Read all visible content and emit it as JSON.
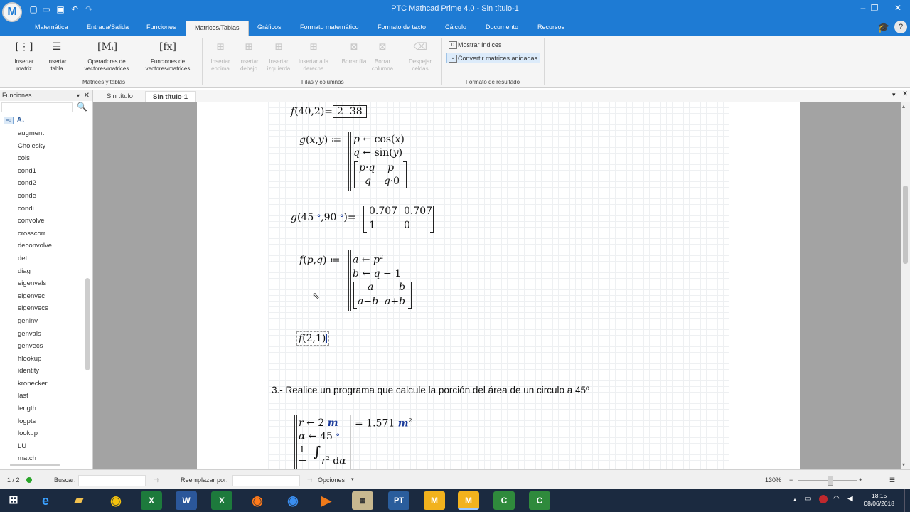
{
  "window": {
    "title": "PTC Mathcad Prime 4.0 - Sin título-1"
  },
  "menu": [
    "Matemática",
    "Entrada/Salida",
    "Funciones",
    "Matrices/Tablas",
    "Gráficos",
    "Formato matemático",
    "Formato de texto",
    "Cálculo",
    "Documento",
    "Recursos"
  ],
  "ribbon": {
    "insert_matrix": "Insertar matriz",
    "insert_table": "Insertar tabla",
    "vec_ops": "Operadores de vectores/matrices",
    "vec_funcs": "Funciones de vectores/matrices",
    "group1": "Matrices y tablas",
    "insert_above": "Insertar encima",
    "insert_below": "Insertar debajo",
    "insert_left": "Insertar izquierda",
    "insert_right": "Insertar a la derecha",
    "delete_row": "Borrar fila",
    "delete_col": "Borrar columna",
    "clear_cells": "Despejar celdas",
    "group2": "Filas y columnas",
    "show_indices": "Mostrar índices",
    "convert_nested": "Convertir matrices anidadas",
    "group3": "Formato de resultado"
  },
  "sidepanel": {
    "title": "Funciones",
    "items": [
      "augment",
      "Cholesky",
      "cols",
      "cond1",
      "cond2",
      "conde",
      "condi",
      "convolve",
      "crosscorr",
      "deconvolve",
      "det",
      "diag",
      "eigenvals",
      "eigenvec",
      "eigenvecs",
      "geninv",
      "genvals",
      "genvecs",
      "hlookup",
      "identity",
      "kronecker",
      "last",
      "length",
      "logpts",
      "lookup",
      "LU",
      "match"
    ]
  },
  "tabs": [
    "Sin título",
    "Sin título-1"
  ],
  "worksheet": {
    "heading": "3.- Realice un programa que calcule la porción del área de un circulo a 45º"
  },
  "status": {
    "page": "1 / 2",
    "find": "Buscar:",
    "replace": "Reemplazar por:",
    "options": "Opciones",
    "zoom": "130%"
  },
  "clock": {
    "time": "18:15",
    "date": "08/06/2018"
  }
}
